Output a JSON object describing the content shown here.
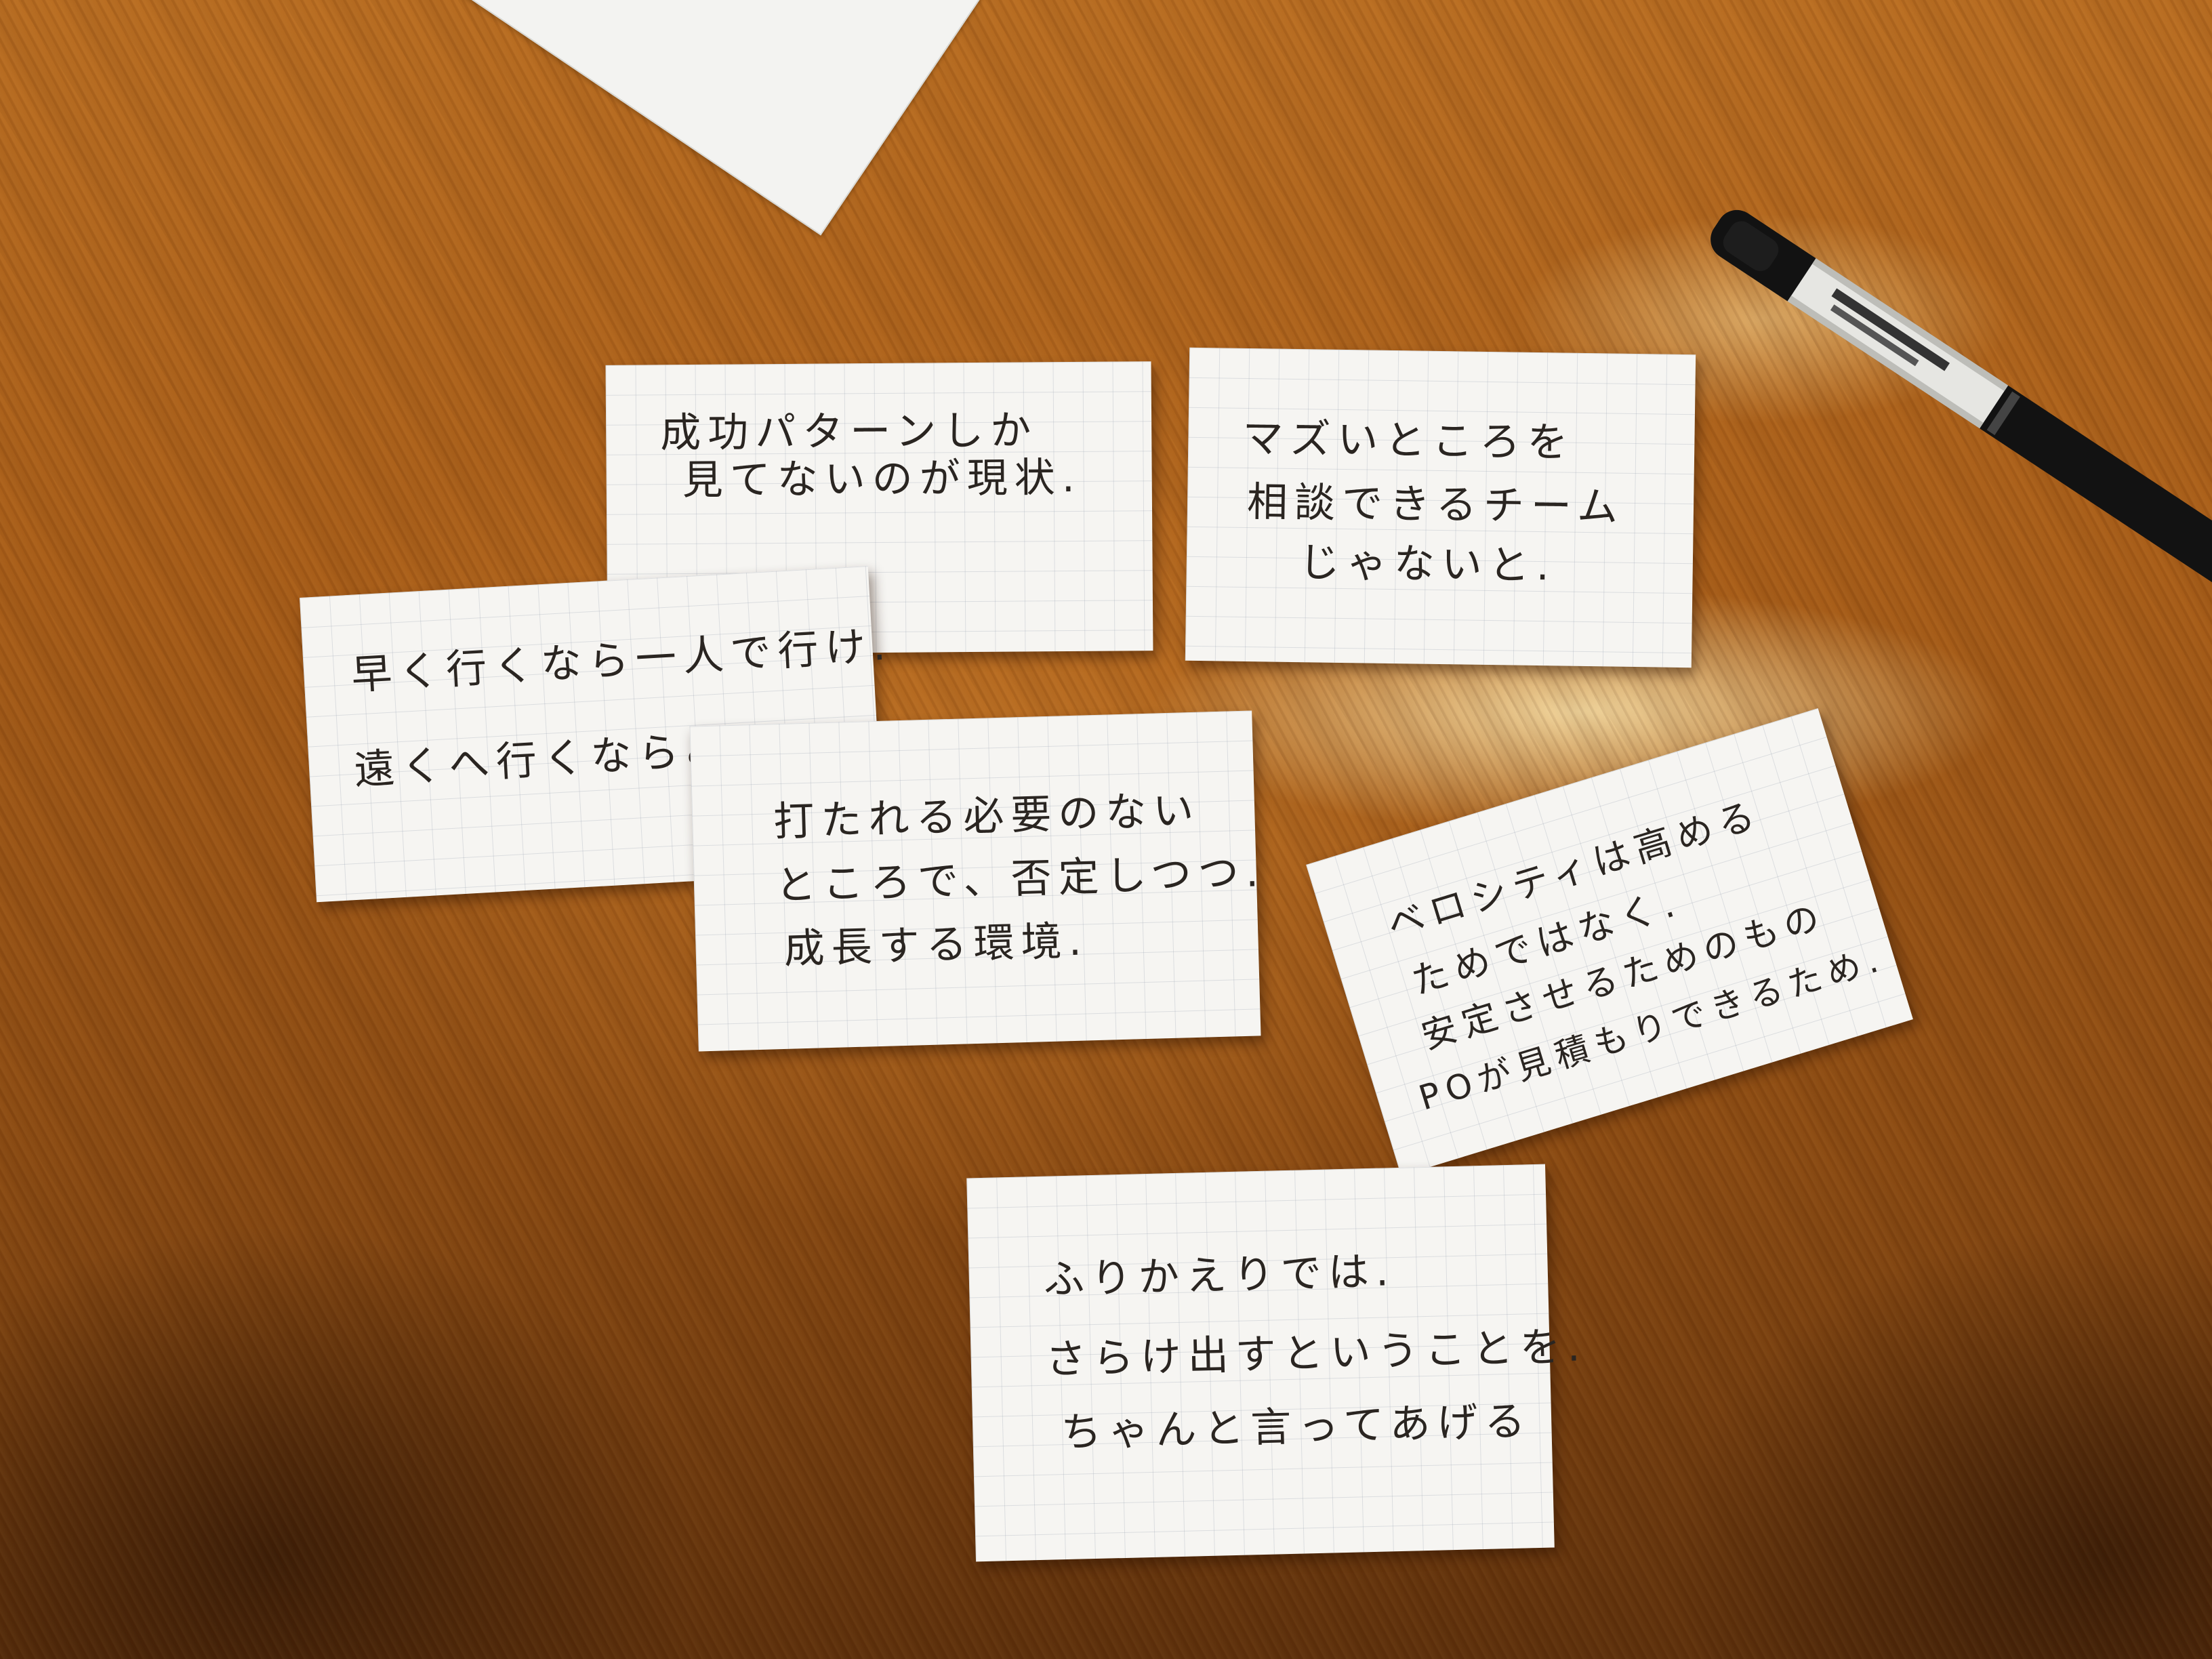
{
  "scene": {
    "description_role": "photo of handwritten sticky cards on a wooden table"
  },
  "cards": [
    {
      "id": "success-pattern",
      "lines": [
        "成功パターンしか",
        "見てないのが現状."
      ]
    },
    {
      "id": "consult",
      "lines": [
        "マズいところを",
        "相談できるチーム",
        "じゃないと."
      ]
    },
    {
      "id": "proverb",
      "lines": [
        "早く行くなら一人で行け.",
        "遠くへ行くならみんなで"
      ]
    },
    {
      "id": "environment",
      "lines": [
        "打たれる必要のない",
        "ところで、否定しつつ.",
        "成長する環境."
      ]
    },
    {
      "id": "velocity",
      "lines": [
        "ベロシティは高める",
        "ためではなく.",
        "安定させるためのもの",
        "POが見積もりできるため."
      ]
    },
    {
      "id": "retrospective",
      "lines": [
        "ふりかえりでは.",
        "さらけ出すということを.",
        "ちゃんと言ってあげる"
      ]
    }
  ],
  "colors": {
    "table": "#a85d18",
    "card": "#f6f5f2",
    "ink": "#2a2521",
    "pen_body": "#111111",
    "pen_label": "#e9e9e6"
  }
}
